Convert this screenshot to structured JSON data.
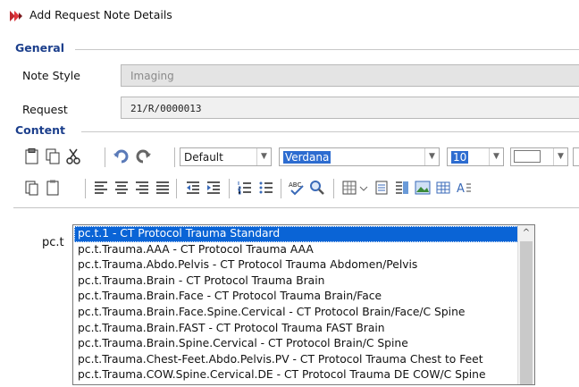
{
  "window": {
    "title": "Add Request Note Details"
  },
  "general": {
    "heading": "General",
    "note_style_label": "Note Style",
    "note_style_value": "Imaging",
    "request_label": "Request",
    "request_value": "21/R/0000013"
  },
  "content": {
    "heading": "Content"
  },
  "toolbar": {
    "style_value": "Default",
    "font_value": "Verdana",
    "size_value": "10",
    "color_value": ""
  },
  "editor": {
    "text": "pc.t"
  },
  "autocomplete": {
    "items": [
      "pc.t.1 - CT Protocol Trauma Standard",
      "pc.t.Trauma.AAA - CT Protocol Trauma AAA",
      "pc.t.Trauma.Abdo.Pelvis - CT Protocol Trauma Abdomen/Pelvis",
      "pc.t.Trauma.Brain - CT Protocol Trauma Brain",
      "pc.t.Trauma.Brain.Face - CT Protocol Trauma Brain/Face",
      "pc.t.Trauma.Brain.Face.Spine.Cervical - CT Protocol Brain/Face/C Spine",
      "pc.t.Trauma.Brain.FAST - CT Protocol Trauma FAST Brain",
      "pc.t.Trauma.Brain.Spine.Cervical - CT Protocol Brain/C Spine",
      "pc.t.Trauma.Chest-Feet.Abdo.Pelvis.PV - CT Protocol Trauma Chest to Feet",
      "pc.t.Trauma.COW.Spine.Cervical.DE - CT Protocol Trauma DE COW/C Spine"
    ],
    "selected_index": 0
  },
  "colors": {
    "accent": "#1c3f8c",
    "selection": "#0a64d6"
  }
}
